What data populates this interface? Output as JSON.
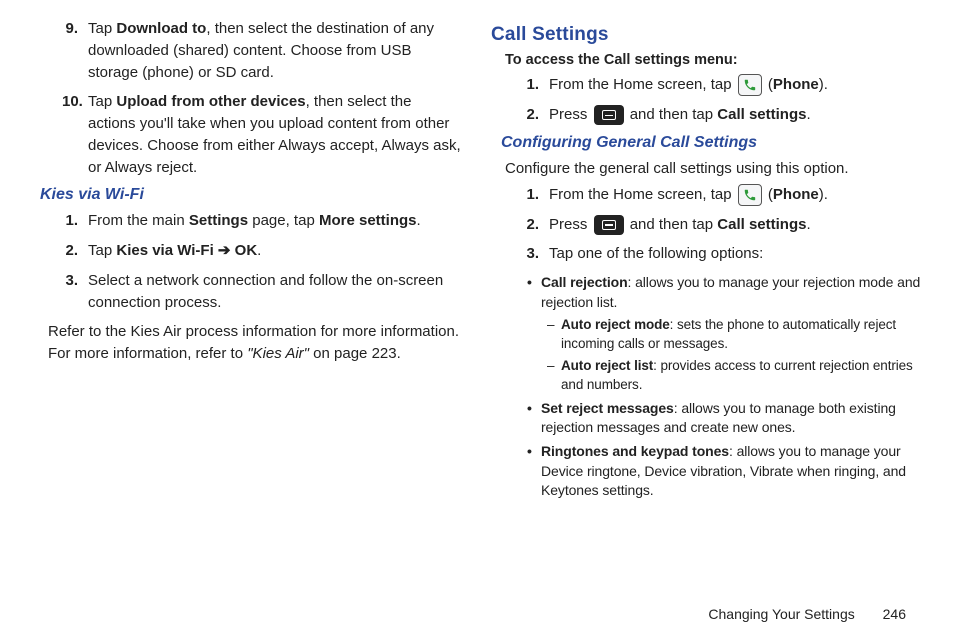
{
  "left": {
    "step9": {
      "num": "9.",
      "t1": "Tap ",
      "b1": "Download to",
      "t2": ", then select the destination of any downloaded (shared) content. Choose from USB storage (phone) or SD card."
    },
    "step10": {
      "num": "10.",
      "t1": "Tap ",
      "b1": "Upload from other devices",
      "t2": ", then select the actions you'll take when you upload content from other devices. Choose from either Always accept, Always ask, or Always reject."
    },
    "kies_heading": "Kies via Wi-Fi",
    "k1": {
      "num": "1.",
      "t1": "From the main ",
      "b1": "Settings",
      "t2": " page, tap ",
      "b2": "More settings",
      "t3": "."
    },
    "k2": {
      "num": "2.",
      "t1": "Tap ",
      "b1": "Kies via Wi-Fi",
      "arrow": " ➔ ",
      "b2": "OK",
      "t2": "."
    },
    "k3": {
      "num": "3.",
      "t1": "Select a network connection and follow the on-screen connection process."
    },
    "refer": {
      "t1": "Refer to the Kies Air process information for more information. For more information, refer to ",
      "ref": "\"Kies Air\"",
      "t2": "  on page 223."
    }
  },
  "right": {
    "call_settings_heading": "Call Settings",
    "access_intro": "To access the Call settings menu:",
    "a1": {
      "num": "1.",
      "t1": "From the Home screen, tap ",
      "t2": " (",
      "b1": "Phone",
      "t3": ")."
    },
    "a2": {
      "num": "2.",
      "t1": "Press ",
      "t2": " and then tap ",
      "b1": "Call settings",
      "t3": "."
    },
    "config_heading": "Configuring General Call Settings",
    "config_intro": "Configure the general call settings using this option.",
    "c1": {
      "num": "1.",
      "t1": "From the Home screen, tap ",
      "t2": " (",
      "b1": "Phone",
      "t3": ")."
    },
    "c2": {
      "num": "2.",
      "t1": "Press ",
      "t2": " and then tap ",
      "b1": "Call settings",
      "t3": "."
    },
    "c3": {
      "num": "3.",
      "t1": "Tap one of the following options:"
    },
    "b_rej": {
      "b": "Call rejection",
      "t": ": allows you to manage your rejection mode and rejection list."
    },
    "d_auto_mode": {
      "b": "Auto reject mode",
      "t": ": sets the phone to automatically reject incoming calls or messages."
    },
    "d_auto_list": {
      "b": "Auto reject list",
      "t": ": provides access to current rejection entries and numbers."
    },
    "b_setrej": {
      "b": "Set reject messages",
      "t": ": allows you to manage both existing rejection messages and create new ones."
    },
    "b_ring": {
      "b": "Ringtones and keypad tones",
      "t": ": allows you to manage your Device ringtone, Device vibration, Vibrate when ringing, and Keytones settings."
    }
  },
  "footer": {
    "section": "Changing Your Settings",
    "page": "246"
  }
}
